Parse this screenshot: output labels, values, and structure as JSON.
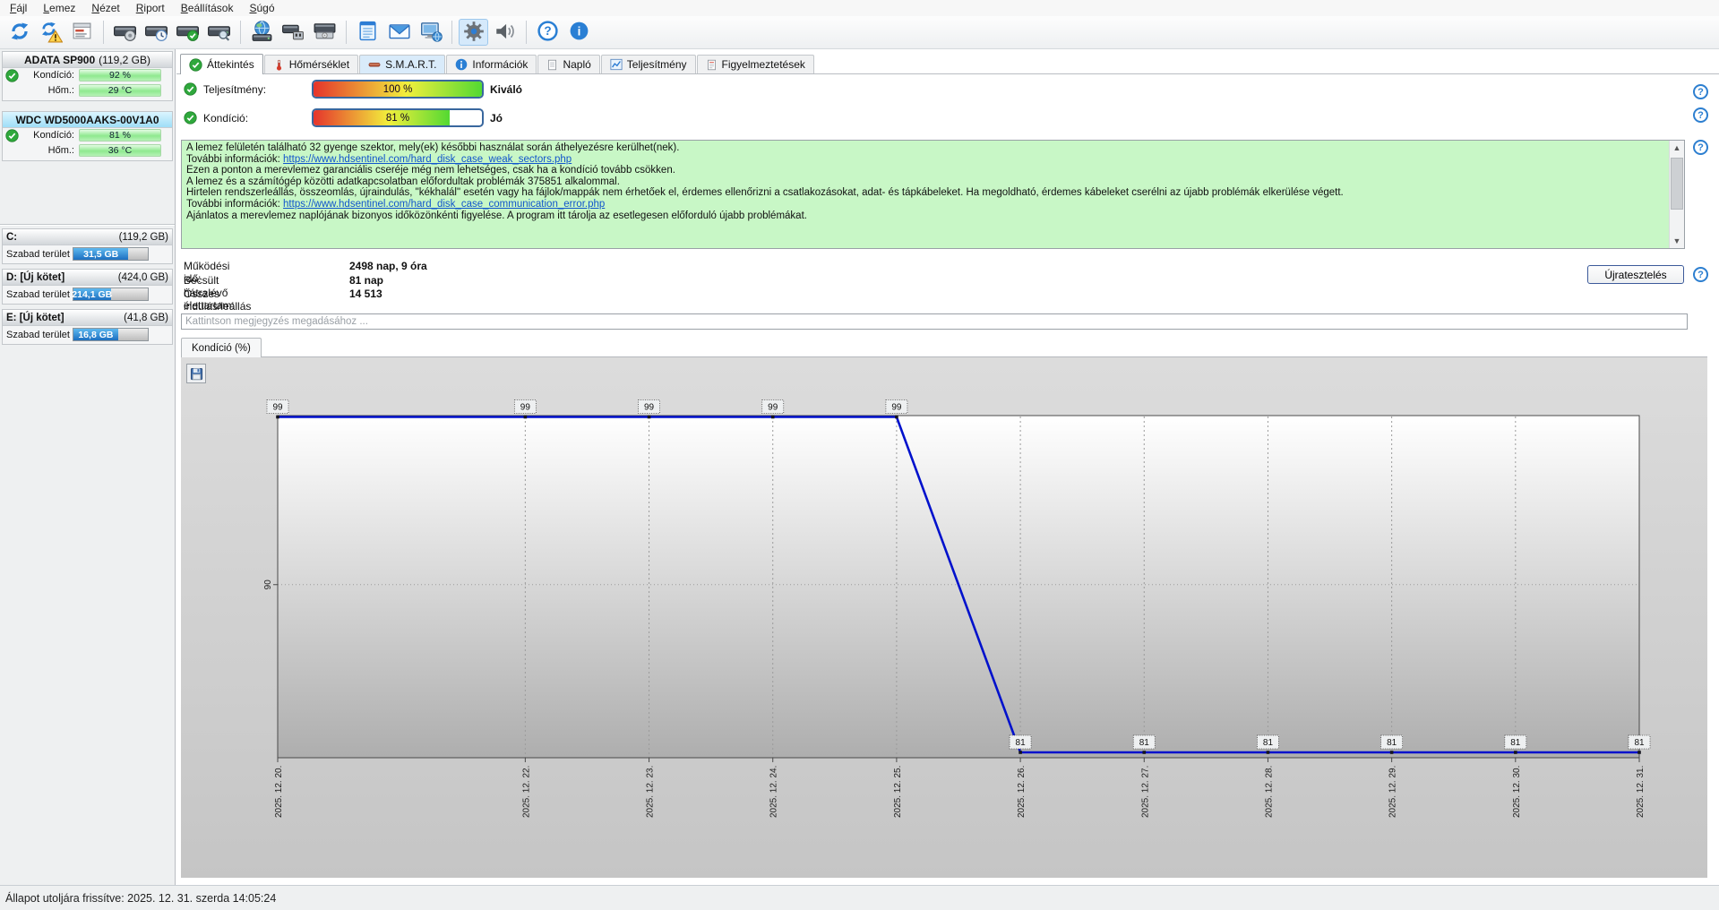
{
  "menu": {
    "items": [
      "Fájl",
      "Lemez",
      "Nézet",
      "Riport",
      "Beállítások",
      "Súgó"
    ]
  },
  "toolbar": {
    "groups": [
      [
        "refresh",
        "refresh-warning",
        "report-window"
      ],
      [
        "disk-status",
        "disk-schedule",
        "disk-ok",
        "disk-search"
      ],
      [
        "disk-network",
        "disk-usb",
        "disk-eject"
      ],
      [
        "notes",
        "email",
        "remote-computer"
      ],
      [
        "settings",
        "sounds"
      ],
      [
        "help",
        "about"
      ]
    ],
    "pressed": "settings"
  },
  "sidebar": {
    "disks": [
      {
        "name": "ADATA SP900",
        "size": "(119,2 GB)",
        "selected": false,
        "rows": [
          {
            "label": "Kondíció:",
            "value": "92 %"
          },
          {
            "label": "Hőm.:",
            "value": "29 °C"
          }
        ]
      },
      {
        "name": "WDC WD5000AAKS-00V1A0",
        "size": "",
        "selected": true,
        "rows": [
          {
            "label": "Kondíció:",
            "value": "81 %"
          },
          {
            "label": "Hőm.:",
            "value": "36 °C"
          }
        ]
      }
    ],
    "volumes": [
      {
        "name": "C:",
        "size": "(119,2 GB)",
        "label": "Szabad terület",
        "value": "31,5 GB",
        "bar_fill_pct": 74
      },
      {
        "name": "D: [Új kötet]",
        "size": "(424,0 GB)",
        "label": "Szabad terület",
        "value": "214,1 GB",
        "bar_fill_pct": 50
      },
      {
        "name": "E: [Új kötet]",
        "size": "(41,8 GB)",
        "label": "Szabad terület",
        "value": "16,8 GB",
        "bar_fill_pct": 60
      }
    ]
  },
  "tabs": [
    {
      "label": "Áttekintés",
      "icon": "check-circle",
      "selected": true
    },
    {
      "label": "Hőmérséklet",
      "icon": "thermometer"
    },
    {
      "label": "S.M.A.R.T.",
      "icon": "smart-bar",
      "highlight": true
    },
    {
      "label": "Információk",
      "icon": "info-circle"
    },
    {
      "label": "Napló",
      "icon": "page"
    },
    {
      "label": "Teljesítmény",
      "icon": "chart-mini"
    },
    {
      "label": "Figyelmeztetések",
      "icon": "warn-page"
    }
  ],
  "overview": {
    "performance": {
      "label": "Teljesítmény:",
      "value": "100 %",
      "rating": "Kiváló",
      "fill_pct": 100
    },
    "condition": {
      "label": "Kondíció:",
      "value": "81 %",
      "rating": "Jó",
      "fill_pct": 81
    },
    "messages": [
      {
        "text": "A lemez felületén található 32 gyenge szektor, mely(ek) későbbi használat során áthelyezésre kerülhet(nek)."
      },
      {
        "text": "További információk: ",
        "link": "https://www.hdsentinel.com/hard_disk_case_weak_sectors.php"
      },
      {
        "text": "Ezen a ponton a merevlemez garanciális cseréje még nem lehetséges, csak ha a kondíció tovább csökken."
      },
      {
        "text": "A lemez és a számítógép közötti adatkapcsolatban előfordultak problémák 375851 alkalommal."
      },
      {
        "text": "Hirtelen rendszerleállás, összeomlás, újraindulás, \"kékhalál\" esetén vagy ha fájlok/mappák nem érhetőek el, érdemes ellenőrizni a csatlakozásokat, adat- és tápkábeleket. Ha megoldható, érdemes kábeleket cserélni az újabb problémák elkerülése végett."
      },
      {
        "text": "További információk: ",
        "link": "https://www.hdsentinel.com/hard_disk_case_communication_error.php"
      },
      {
        "text": "Ajánlatos a merevlemez naplójának bizonyos időközönkénti figyelése. A program itt tárolja az esetlegesen előforduló újabb problémákat."
      }
    ],
    "stats": [
      {
        "label": "Működési idő:",
        "value": "2498 nap, 9 óra"
      },
      {
        "label": "Becsült hátralévő élettartam:",
        "value": "81 nap"
      },
      {
        "label": "Összes indulás/leállás száma:",
        "value": "14 513"
      }
    ],
    "retest_button": "Újratesztelés",
    "comment_placeholder": "Kattintson megjegyzés megadásához ..."
  },
  "chart_data": {
    "type": "line",
    "title": "Kondíció  (%)",
    "x": [
      "2025. 12. 20.",
      "2025. 12. 22.",
      "2025. 12. 23.",
      "2025. 12. 24.",
      "2025. 12. 25.",
      "2025. 12. 26.",
      "2025. 12. 27.",
      "2025. 12. 28.",
      "2025. 12. 29.",
      "2025. 12. 30.",
      "2025. 12. 31."
    ],
    "days": [
      20,
      22,
      23,
      24,
      25,
      26,
      27,
      28,
      29,
      30,
      31
    ],
    "values": [
      99,
      99,
      99,
      99,
      99,
      81,
      81,
      81,
      81,
      81,
      81
    ],
    "y_max": 99,
    "y_min": 81,
    "y_tick": "90",
    "grid": true,
    "line_color": "#0011cc",
    "ylabel": "Kondíció (%)"
  },
  "statusbar": {
    "text": "Állapot utoljára frissítve: 2025. 12. 31. szerda 14:05:24"
  }
}
